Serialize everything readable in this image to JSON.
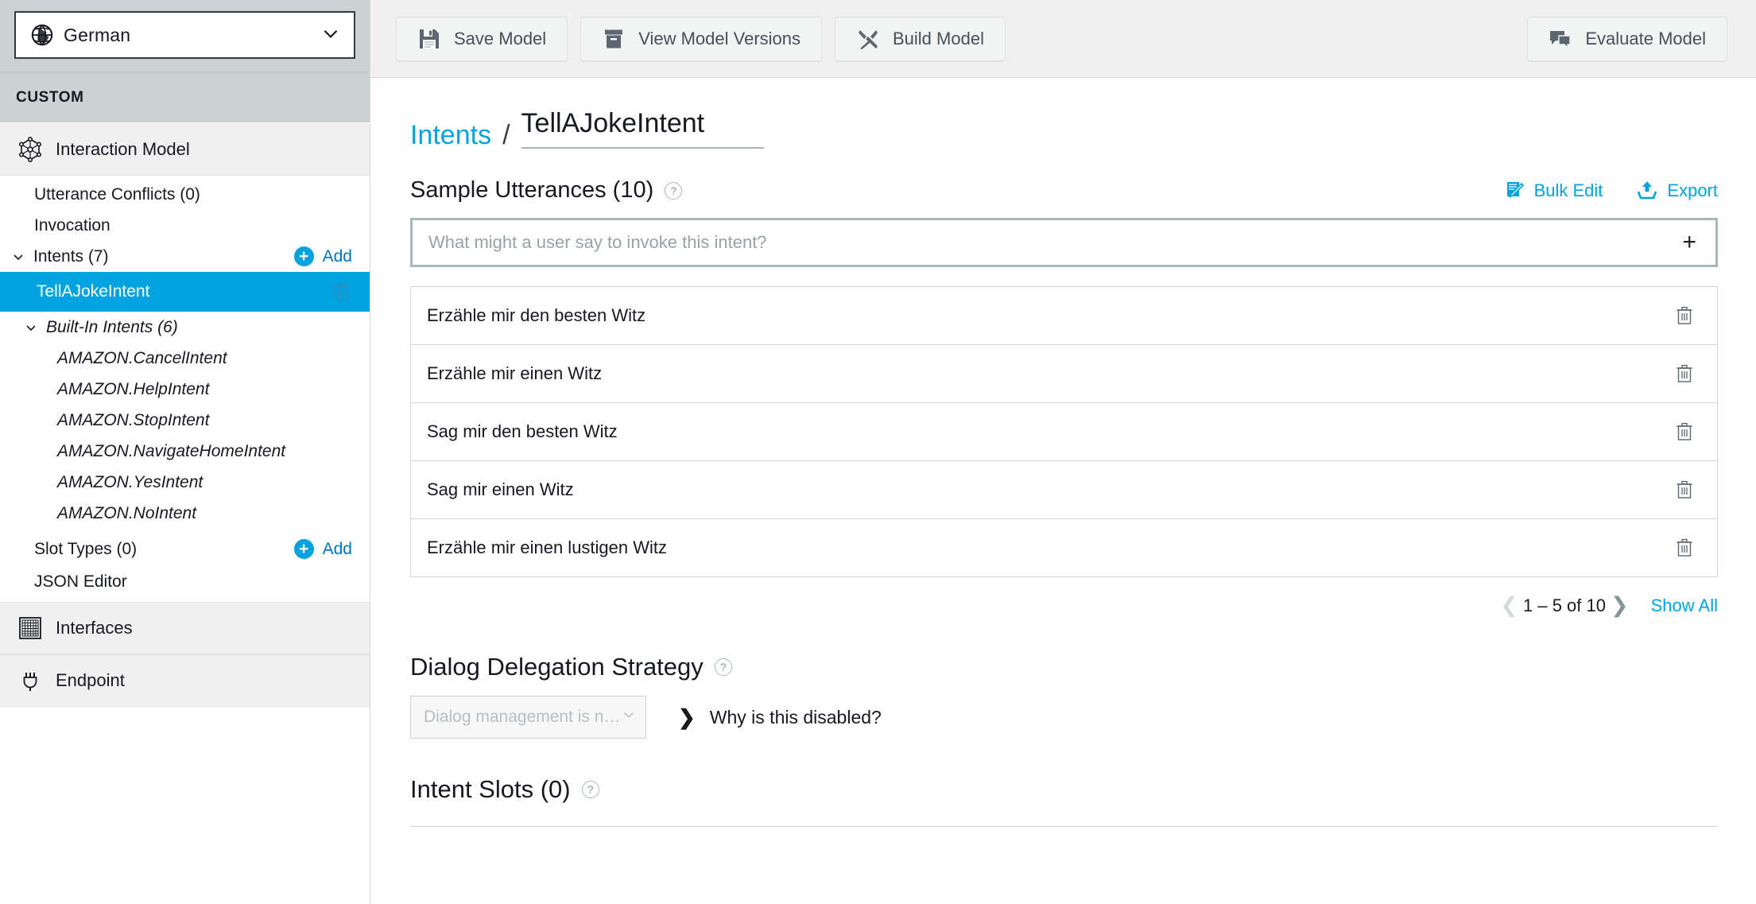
{
  "sidebar": {
    "language_selector": {
      "value": "German",
      "icon": "globe-icon",
      "caret": "chevron-down-icon"
    },
    "section_header": "CUSTOM",
    "interaction_model": {
      "label": "Interaction Model",
      "icon": "interaction-model-icon"
    },
    "tree": [
      {
        "label": "Utterance Conflicts (0)",
        "level": 1
      },
      {
        "label": "Invocation",
        "level": 1
      },
      {
        "label": "Intents (7)",
        "level": 1,
        "chevron": true,
        "add": "Add"
      },
      {
        "label": "TellAJokeIntent",
        "level": 2,
        "selected": true,
        "trash": true
      },
      {
        "label": "Built-In Intents (6)",
        "level": 2,
        "chevron": true,
        "italic": true
      },
      {
        "label": "AMAZON.CancelIntent",
        "level": 3,
        "italic": true
      },
      {
        "label": "AMAZON.HelpIntent",
        "level": 3,
        "italic": true
      },
      {
        "label": "AMAZON.StopIntent",
        "level": 3,
        "italic": true
      },
      {
        "label": "AMAZON.NavigateHomeIntent",
        "level": 3,
        "italic": true
      },
      {
        "label": "AMAZON.YesIntent",
        "level": 3,
        "italic": true
      },
      {
        "label": "AMAZON.NoIntent",
        "level": 3,
        "italic": true
      },
      {
        "label": "Slot Types (0)",
        "level": 1,
        "add": "Add"
      },
      {
        "label": "JSON Editor",
        "level": 1
      }
    ],
    "bottom_items": [
      {
        "label": "Interfaces",
        "icon": "interfaces-grid-icon"
      },
      {
        "label": "Endpoint",
        "icon": "plug-icon"
      }
    ],
    "add_label": "Add",
    "accent_color": "#00a3e0",
    "link_color": "#0073bb"
  },
  "toolbar": {
    "buttons": [
      {
        "label": "Save Model",
        "icon": "floppy-disk-icon"
      },
      {
        "label": "View Model Versions",
        "icon": "archive-box-icon"
      },
      {
        "label": "Build Model",
        "icon": "hammer-wrench-icon"
      }
    ],
    "right_button": {
      "label": "Evaluate Model",
      "icon": "chat-bubbles-icon"
    }
  },
  "breadcrumb": {
    "parent": "Intents",
    "separator": "/",
    "current": "TellAJokeIntent"
  },
  "utterances_section": {
    "title": "Sample Utterances (10)",
    "help_icon": "question-mark-icon",
    "bulk_edit": {
      "label": "Bulk Edit",
      "icon": "bulk-edit-pencil-icon"
    },
    "export": {
      "label": "Export",
      "icon": "upload-arrow-icon"
    },
    "input": {
      "value": "",
      "placeholder": "What might a user say to invoke this intent?",
      "add_icon": "plus-icon"
    },
    "rows": [
      {
        "text": "Erzähle mir den besten Witz",
        "delete_icon": "trash-icon"
      },
      {
        "text": "Erzähle mir einen Witz",
        "delete_icon": "trash-icon"
      },
      {
        "text": "Sag mir den besten Witz",
        "delete_icon": "trash-icon"
      },
      {
        "text": "Sag mir einen Witz",
        "delete_icon": "trash-icon"
      },
      {
        "text": "Erzähle mir einen lustigen Witz",
        "delete_icon": "trash-icon"
      }
    ],
    "pagination": {
      "prev_icon": "chevron-left-icon",
      "range": "1 – 5 of 10",
      "next_icon": "chevron-right-icon",
      "show_all": "Show All"
    }
  },
  "dialog_delegation": {
    "title": "Dialog Delegation Strategy",
    "help_icon": "question-mark-icon",
    "select_value": "Dialog management is not enabled f...",
    "select_caret": "chevron-down-icon",
    "why_disabled": "Why is this disabled?",
    "why_chevron": "chevron-right-icon"
  },
  "intent_slots": {
    "title": "Intent Slots (0)",
    "help_icon": "question-mark-icon"
  }
}
